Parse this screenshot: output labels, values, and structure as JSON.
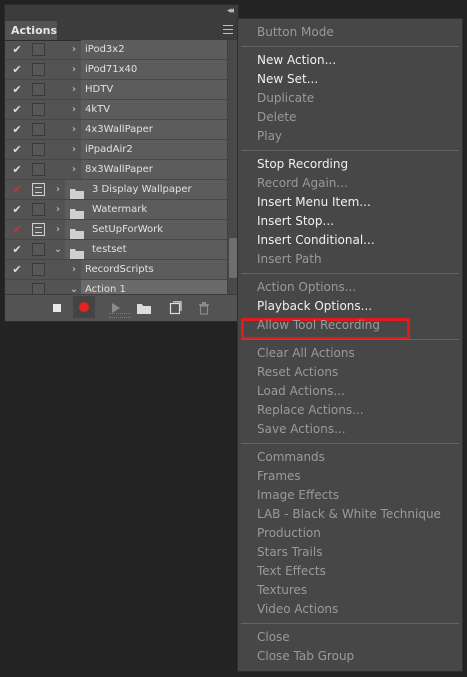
{
  "panel": {
    "tab_label": "Actions",
    "collapse_glyph": "◂◂",
    "menu_icon": "hamburger-icon",
    "rows": [
      {
        "check": "✔",
        "check_red": false,
        "modal": false,
        "chevron": "›",
        "folder": false,
        "name": "iPod3x2",
        "level": 1
      },
      {
        "check": "✔",
        "check_red": false,
        "modal": false,
        "chevron": "›",
        "folder": false,
        "name": "iPod71x40",
        "level": 1
      },
      {
        "check": "✔",
        "check_red": false,
        "modal": false,
        "chevron": "›",
        "folder": false,
        "name": "HDTV",
        "level": 1
      },
      {
        "check": "✔",
        "check_red": false,
        "modal": false,
        "chevron": "›",
        "folder": false,
        "name": "4kTV",
        "level": 1
      },
      {
        "check": "✔",
        "check_red": false,
        "modal": false,
        "chevron": "›",
        "folder": false,
        "name": "4x3WallPaper",
        "level": 1
      },
      {
        "check": "✔",
        "check_red": false,
        "modal": false,
        "chevron": "›",
        "folder": false,
        "name": "iPpadAir2",
        "level": 1
      },
      {
        "check": "✔",
        "check_red": false,
        "modal": false,
        "chevron": "›",
        "folder": false,
        "name": "8x3WallPaper",
        "level": 1
      },
      {
        "check": "✔",
        "check_red": true,
        "modal": true,
        "chevron": "›",
        "folder": true,
        "name": "3 Display Wallpaper",
        "level": 0
      },
      {
        "check": "✔",
        "check_red": false,
        "modal": false,
        "chevron": "›",
        "folder": true,
        "name": "Watermark",
        "level": 0
      },
      {
        "check": "✔",
        "check_red": true,
        "modal": true,
        "chevron": "›",
        "folder": true,
        "name": "SetUpForWork",
        "level": 0
      },
      {
        "check": "✔",
        "check_red": false,
        "modal": false,
        "chevron": "⌄",
        "folder": true,
        "name": "testset",
        "level": 0
      },
      {
        "check": "✔",
        "check_red": false,
        "modal": false,
        "chevron": "›",
        "folder": false,
        "name": "RecordScripts",
        "level": 1
      },
      {
        "check": "",
        "check_red": false,
        "modal": false,
        "chevron": "⌄",
        "folder": false,
        "name": "Action 1",
        "level": 1,
        "selected": true
      }
    ],
    "toolbar": [
      "stop-icon",
      "record-icon",
      "play-icon",
      "new-set-icon",
      "new-action-icon",
      "delete-icon"
    ]
  },
  "menu": {
    "items": [
      {
        "label": "Button Mode",
        "enabled": false
      },
      {
        "sep": true
      },
      {
        "label": "New Action...",
        "enabled": true
      },
      {
        "label": "New Set...",
        "enabled": true
      },
      {
        "label": "Duplicate",
        "enabled": false
      },
      {
        "label": "Delete",
        "enabled": false
      },
      {
        "label": "Play",
        "enabled": false
      },
      {
        "sep": true
      },
      {
        "label": "Stop Recording",
        "enabled": true
      },
      {
        "label": "Record Again...",
        "enabled": false
      },
      {
        "label": "Insert Menu Item...",
        "enabled": true
      },
      {
        "label": "Insert Stop...",
        "enabled": true
      },
      {
        "label": "Insert Conditional...",
        "enabled": true
      },
      {
        "label": "Insert Path",
        "enabled": false
      },
      {
        "sep": true
      },
      {
        "label": "Action Options...",
        "enabled": false
      },
      {
        "label": "Playback Options...",
        "enabled": true
      },
      {
        "label": "Allow Tool Recording",
        "enabled": false,
        "highlighted": true
      },
      {
        "sep": true
      },
      {
        "label": "Clear All Actions",
        "enabled": false
      },
      {
        "label": "Reset Actions",
        "enabled": false
      },
      {
        "label": "Load Actions...",
        "enabled": false
      },
      {
        "label": "Replace Actions...",
        "enabled": false
      },
      {
        "label": "Save Actions...",
        "enabled": false
      },
      {
        "sep": true
      },
      {
        "label": "Commands",
        "enabled": false
      },
      {
        "label": "Frames",
        "enabled": false
      },
      {
        "label": "Image Effects",
        "enabled": false
      },
      {
        "label": "LAB - Black & White Technique",
        "enabled": false
      },
      {
        "label": "Production",
        "enabled": false
      },
      {
        "label": "Stars Trails",
        "enabled": false
      },
      {
        "label": "Text Effects",
        "enabled": false
      },
      {
        "label": "Textures",
        "enabled": false
      },
      {
        "label": "Video Actions",
        "enabled": false
      },
      {
        "sep": true
      },
      {
        "label": "Close",
        "enabled": false
      },
      {
        "label": "Close Tab Group",
        "enabled": false
      }
    ]
  },
  "colors": {
    "highlight_box": "#e01b1b",
    "record_red": "#e02424",
    "check_red": "#d42f2f"
  }
}
